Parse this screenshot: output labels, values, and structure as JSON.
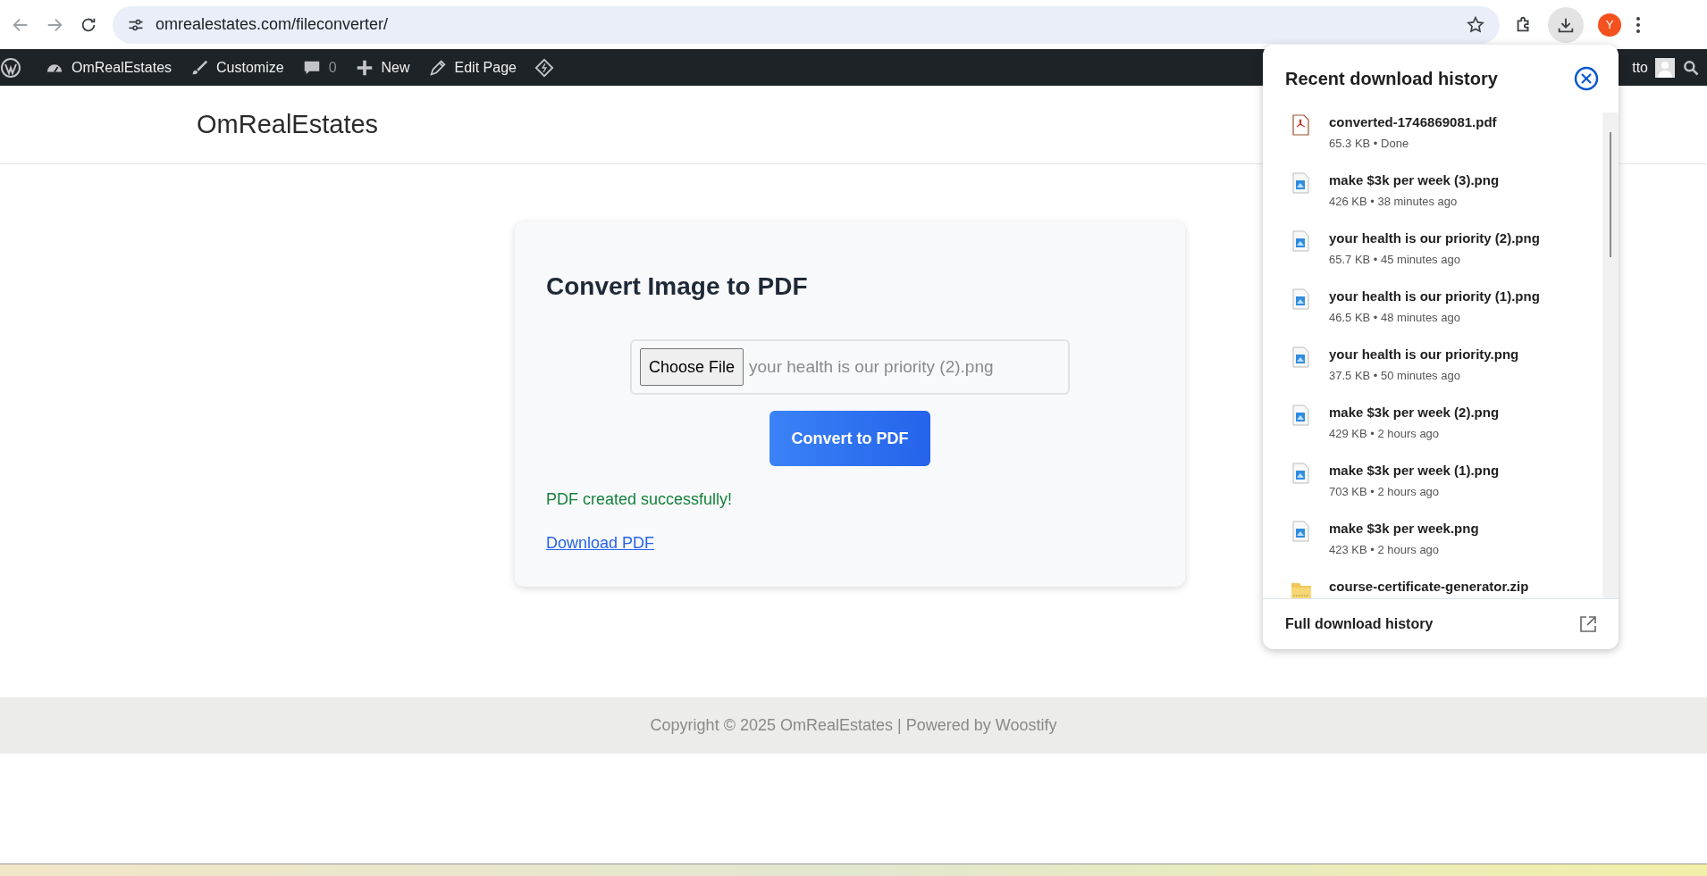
{
  "browser": {
    "url": "omrealestates.com/fileconverter/",
    "profile_initial": "Y"
  },
  "admin_bar": {
    "items": [
      {
        "kind": "site",
        "label": "OmRealEstates"
      },
      {
        "kind": "customize",
        "label": "Customize"
      },
      {
        "kind": "comments",
        "label": "0"
      },
      {
        "kind": "new",
        "label": "New"
      },
      {
        "kind": "edit",
        "label": "Edit Page"
      },
      {
        "kind": "plugin"
      }
    ],
    "user_label": "tto"
  },
  "site": {
    "title": "OmRealEstates"
  },
  "converter": {
    "heading": "Convert Image to PDF",
    "choose_button": "Choose File",
    "file_name": "your health is our priority (2).png",
    "convert_button": "Convert to PDF",
    "message": "PDF created successfully!",
    "download_link": "Download PDF"
  },
  "footer": {
    "text": "Copyright © 2025 OmRealEstates | Powered by Woostify"
  },
  "downloads": {
    "title": "Recent download history",
    "items": [
      {
        "kind": "pdf",
        "name": "converted-1746869081.pdf",
        "detail": "65.3 KB • Done"
      },
      {
        "kind": "image",
        "name": "make $3k per week (3).png",
        "detail": "426 KB • 38 minutes ago"
      },
      {
        "kind": "image",
        "name": "your health is our priority (2).png",
        "detail": "65.7 KB • 45 minutes ago"
      },
      {
        "kind": "image",
        "name": "your health is our priority (1).png",
        "detail": "46.5 KB • 48 minutes ago"
      },
      {
        "kind": "image",
        "name": "your health is our priority.png",
        "detail": "37.5 KB • 50 minutes ago"
      },
      {
        "kind": "image",
        "name": "make $3k per week (2).png",
        "detail": "429 KB • 2 hours ago"
      },
      {
        "kind": "image",
        "name": "make $3k per week (1).png",
        "detail": "703 KB • 2 hours ago"
      },
      {
        "kind": "image",
        "name": "make $3k per week.png",
        "detail": "423 KB • 2 hours ago"
      },
      {
        "kind": "zip",
        "name": "course-certificate-generator.zip"
      }
    ],
    "footer_link": "Full download history"
  }
}
